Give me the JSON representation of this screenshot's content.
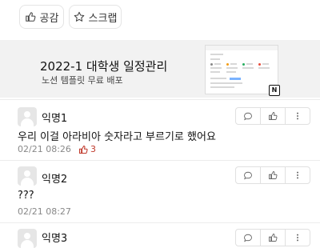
{
  "actions": {
    "like_label": "공감",
    "scrap_label": "스크랩"
  },
  "banner": {
    "title": "2022-1 대학생 일정관리",
    "subtitle": "노션 템플릿 무료 배포"
  },
  "comments": [
    {
      "author": "익명1",
      "text": "우리 이걸 아라비아 숫자라고 부르기로 했어요",
      "time": "02/21 08:26",
      "likes": "3"
    },
    {
      "author": "익명2",
      "text": "???",
      "time": "02/21 08:27",
      "likes": ""
    },
    {
      "author": "익명3",
      "text": "",
      "time": "",
      "likes": ""
    }
  ],
  "colors": {
    "like_red": "#c0392b",
    "meta_gray": "#888888",
    "banner_bg": "#f2f2f2"
  },
  "icons": [
    "thumbs-up-icon",
    "star-icon",
    "chat-bubble-icon",
    "thumbs-up-icon",
    "more-vertical-icon"
  ]
}
